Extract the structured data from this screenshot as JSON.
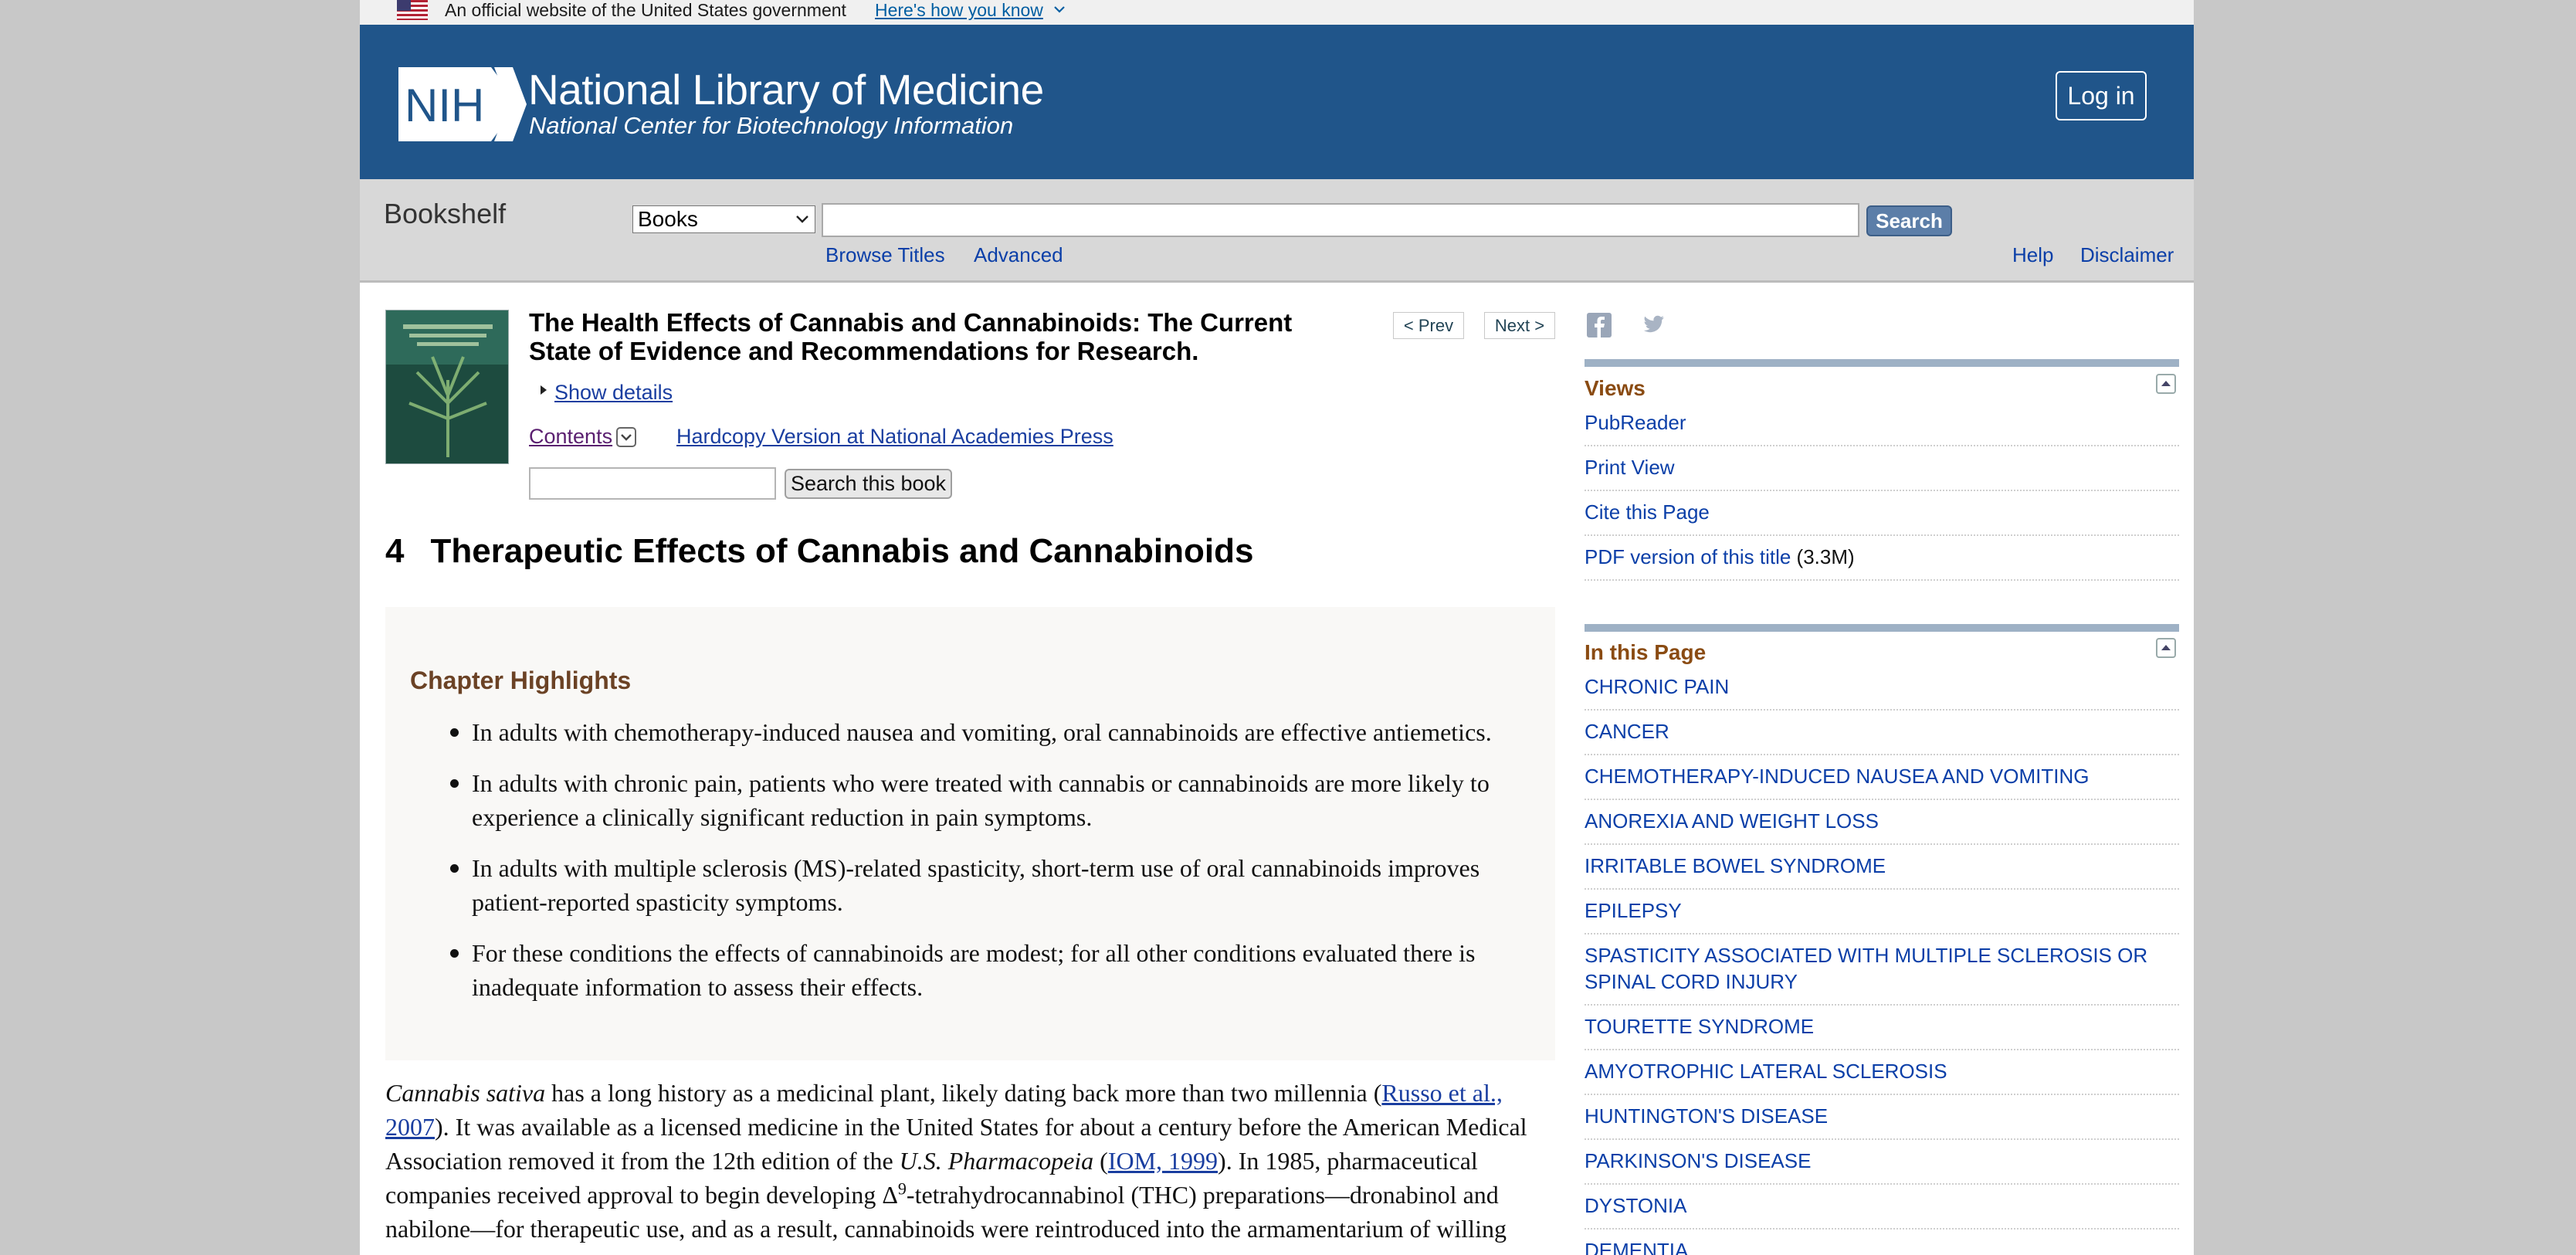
{
  "gov_banner": {
    "text": "An official website of the United States government",
    "link": "Here's how you know"
  },
  "header": {
    "logo_text": "NIH",
    "title": "National Library of Medicine",
    "subtitle": "National Center for Biotechnology Information",
    "login": "Log in",
    "colors": {
      "header_bg": "#20558a",
      "gov_banner_bg": "#f0f0f0"
    }
  },
  "shelf": {
    "title": "Bookshelf",
    "db_selected": "Books",
    "search_value": "",
    "search_button": "Search",
    "links": {
      "browse": "Browse Titles",
      "advanced": "Advanced",
      "help": "Help",
      "disclaimer": "Disclaimer"
    }
  },
  "book": {
    "title": "The Health Effects of Cannabis and Cannabinoids: The Current State of Evidence and Recommendations for Research.",
    "prev": "< Prev",
    "next": "Next >",
    "show_details": "Show details",
    "contents": "Contents",
    "hardcopy": "Hardcopy Version at National Academies Press",
    "search_value": "",
    "search_button": "Search this book"
  },
  "chapter": {
    "number": "4",
    "title": "Therapeutic Effects of Cannabis and Cannabinoids",
    "highlights_title": "Chapter Highlights",
    "highlights": [
      "In adults with chemotherapy-induced nausea and vomiting, oral cannabinoids are effective antiemetics.",
      "In adults with chronic pain, patients who were treated with cannabis or cannabinoids are more likely to experience a clinically significant reduction in pain symptoms.",
      "In adults with multiple sclerosis (MS)-related spasticity, short-term use of oral cannabinoids improves patient-reported spasticity symptoms.",
      "For these conditions the effects of cannabinoids are modest; for all other conditions evaluated there is inadequate information to assess their effects."
    ],
    "body": {
      "p1_species": "Cannabis sativa",
      "p1_a": " has a long history as a medicinal plant, likely dating back more than two millennia (",
      "p1_ref1": "Russo et al., 2007",
      "p1_b": "). It was available as a licensed medicine in the United States for about a century before the American Medical Association removed it from the 12th edition of the ",
      "p1_pharma": "U.S. Pharmacopeia",
      "p1_c": " (",
      "p1_ref2": "IOM, 1999",
      "p1_d": "). In 1985, pharmaceutical companies received approval to begin developing Δ",
      "p1_sup": "9",
      "p1_e": "-tetrahydrocannabinol (THC) preparations—dronabinol and nabilone—for therapeutic use, and as a result, cannabinoids were reintroduced into the armamentarium of willing"
    }
  },
  "views_panel": {
    "title": "Views",
    "items": [
      "PubReader",
      "Print View",
      "Cite this Page",
      "PDF version of this title"
    ],
    "pdf_size": "(3.3M)"
  },
  "in_page_panel": {
    "title": "In this Page",
    "items": [
      "CHRONIC PAIN",
      "CANCER",
      "CHEMOTHERAPY-INDUCED NAUSEA AND VOMITING",
      "ANOREXIA AND WEIGHT LOSS",
      "IRRITABLE BOWEL SYNDROME",
      "EPILEPSY",
      "SPASTICITY ASSOCIATED WITH MULTIPLE SCLEROSIS OR SPINAL CORD INJURY",
      "TOURETTE SYNDROME",
      "AMYOTROPHIC LATERAL SCLEROSIS",
      "HUNTINGTON'S DISEASE",
      "PARKINSON'S DISEASE",
      "DYSTONIA",
      "DEMENTIA"
    ]
  }
}
